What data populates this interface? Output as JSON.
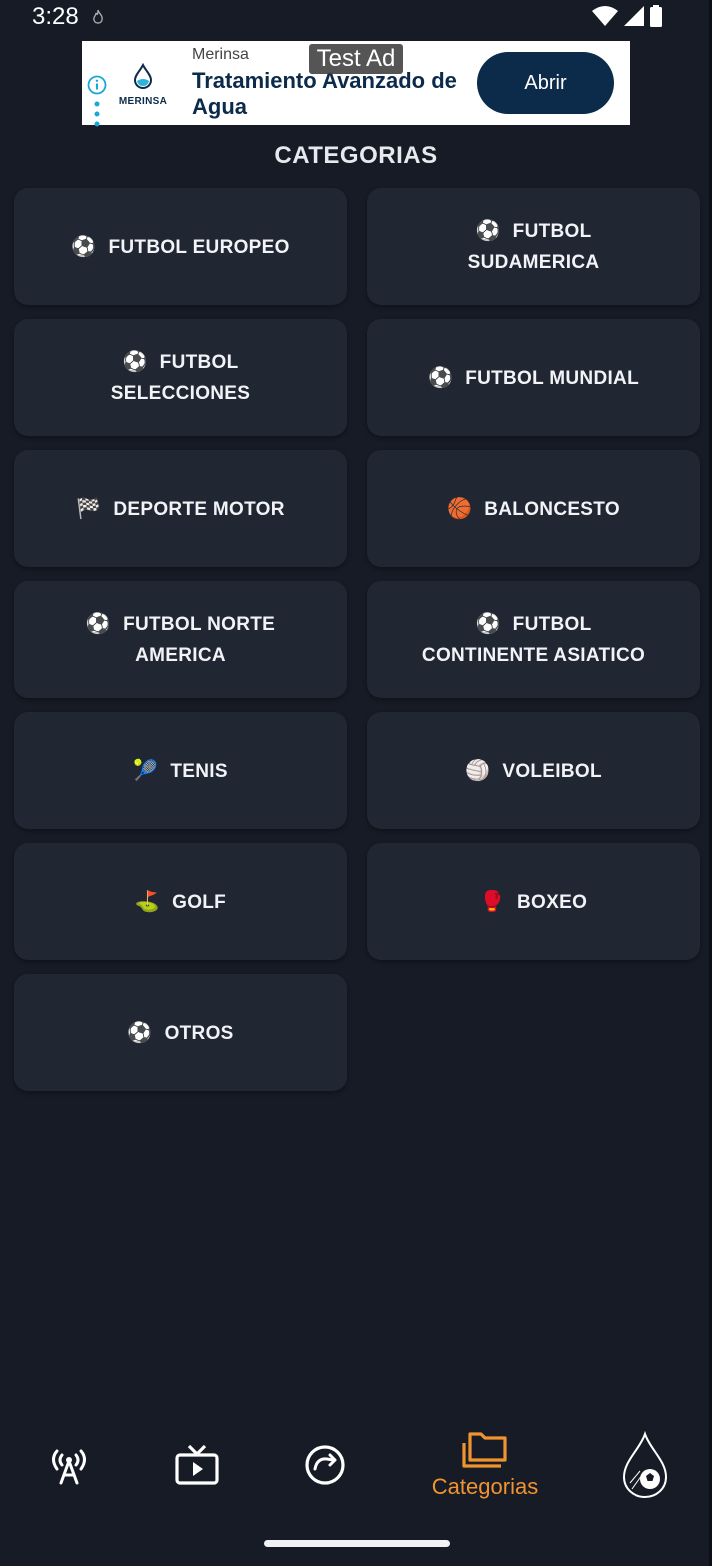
{
  "status_bar": {
    "time": "3:28",
    "icons": [
      "flame-icon",
      "wifi-icon",
      "signal-icon",
      "battery-icon"
    ]
  },
  "ad": {
    "brand": "Merinsa",
    "logo_text": "MERINSA",
    "headline": "Tratamiento Avanzado de Agua",
    "button_label": "Abrir",
    "test_label": "Test Ad",
    "accent_color": "#0c2b4a"
  },
  "page": {
    "title": "CATEGORIAS"
  },
  "categories": [
    {
      "icon": "⚽",
      "icon_name": "soccer-ball-icon",
      "label": "FUTBOL EUROPEO"
    },
    {
      "icon": "⚽",
      "icon_name": "soccer-ball-icon",
      "label": "FUTBOL SUDAMERICA"
    },
    {
      "icon": "⚽",
      "icon_name": "soccer-ball-icon",
      "label": "FUTBOL SELECCIONES"
    },
    {
      "icon": "⚽",
      "icon_name": "soccer-ball-icon",
      "label": "FUTBOL MUNDIAL"
    },
    {
      "icon": "🏁",
      "icon_name": "checkered-flag-icon",
      "label": "DEPORTE MOTOR"
    },
    {
      "icon": "🏀",
      "icon_name": "basketball-icon",
      "label": "BALONCESTO"
    },
    {
      "icon": "⚽",
      "icon_name": "soccer-ball-icon",
      "label": "FUTBOL NORTE AMERICA"
    },
    {
      "icon": "⚽",
      "icon_name": "soccer-ball-icon",
      "label": "FUTBOL CONTINENTE ASIATICO"
    },
    {
      "icon": "🎾",
      "icon_name": "tennis-icon",
      "label": "TENIS"
    },
    {
      "icon": "🏐",
      "icon_name": "volleyball-icon",
      "label": "VOLEIBOL"
    },
    {
      "icon": "⛳",
      "icon_name": "golf-icon",
      "label": "GOLF"
    },
    {
      "icon": "🥊",
      "icon_name": "boxing-glove-icon",
      "label": "BOXEO"
    },
    {
      "icon": "⚽",
      "icon_name": "soccer-ball-icon",
      "label": "OTROS"
    }
  ],
  "bottom_nav": {
    "items": [
      {
        "icon_name": "broadcast-antenna-icon"
      },
      {
        "icon_name": "tv-icon"
      },
      {
        "icon_name": "replay-icon"
      },
      {
        "icon_name": "folder-icon",
        "label": "Categorias",
        "active": true
      },
      {
        "icon_name": "app-logo-icon"
      }
    ],
    "active_color": "#f19430"
  },
  "colors": {
    "background": "#161b26",
    "card": "#212633"
  }
}
